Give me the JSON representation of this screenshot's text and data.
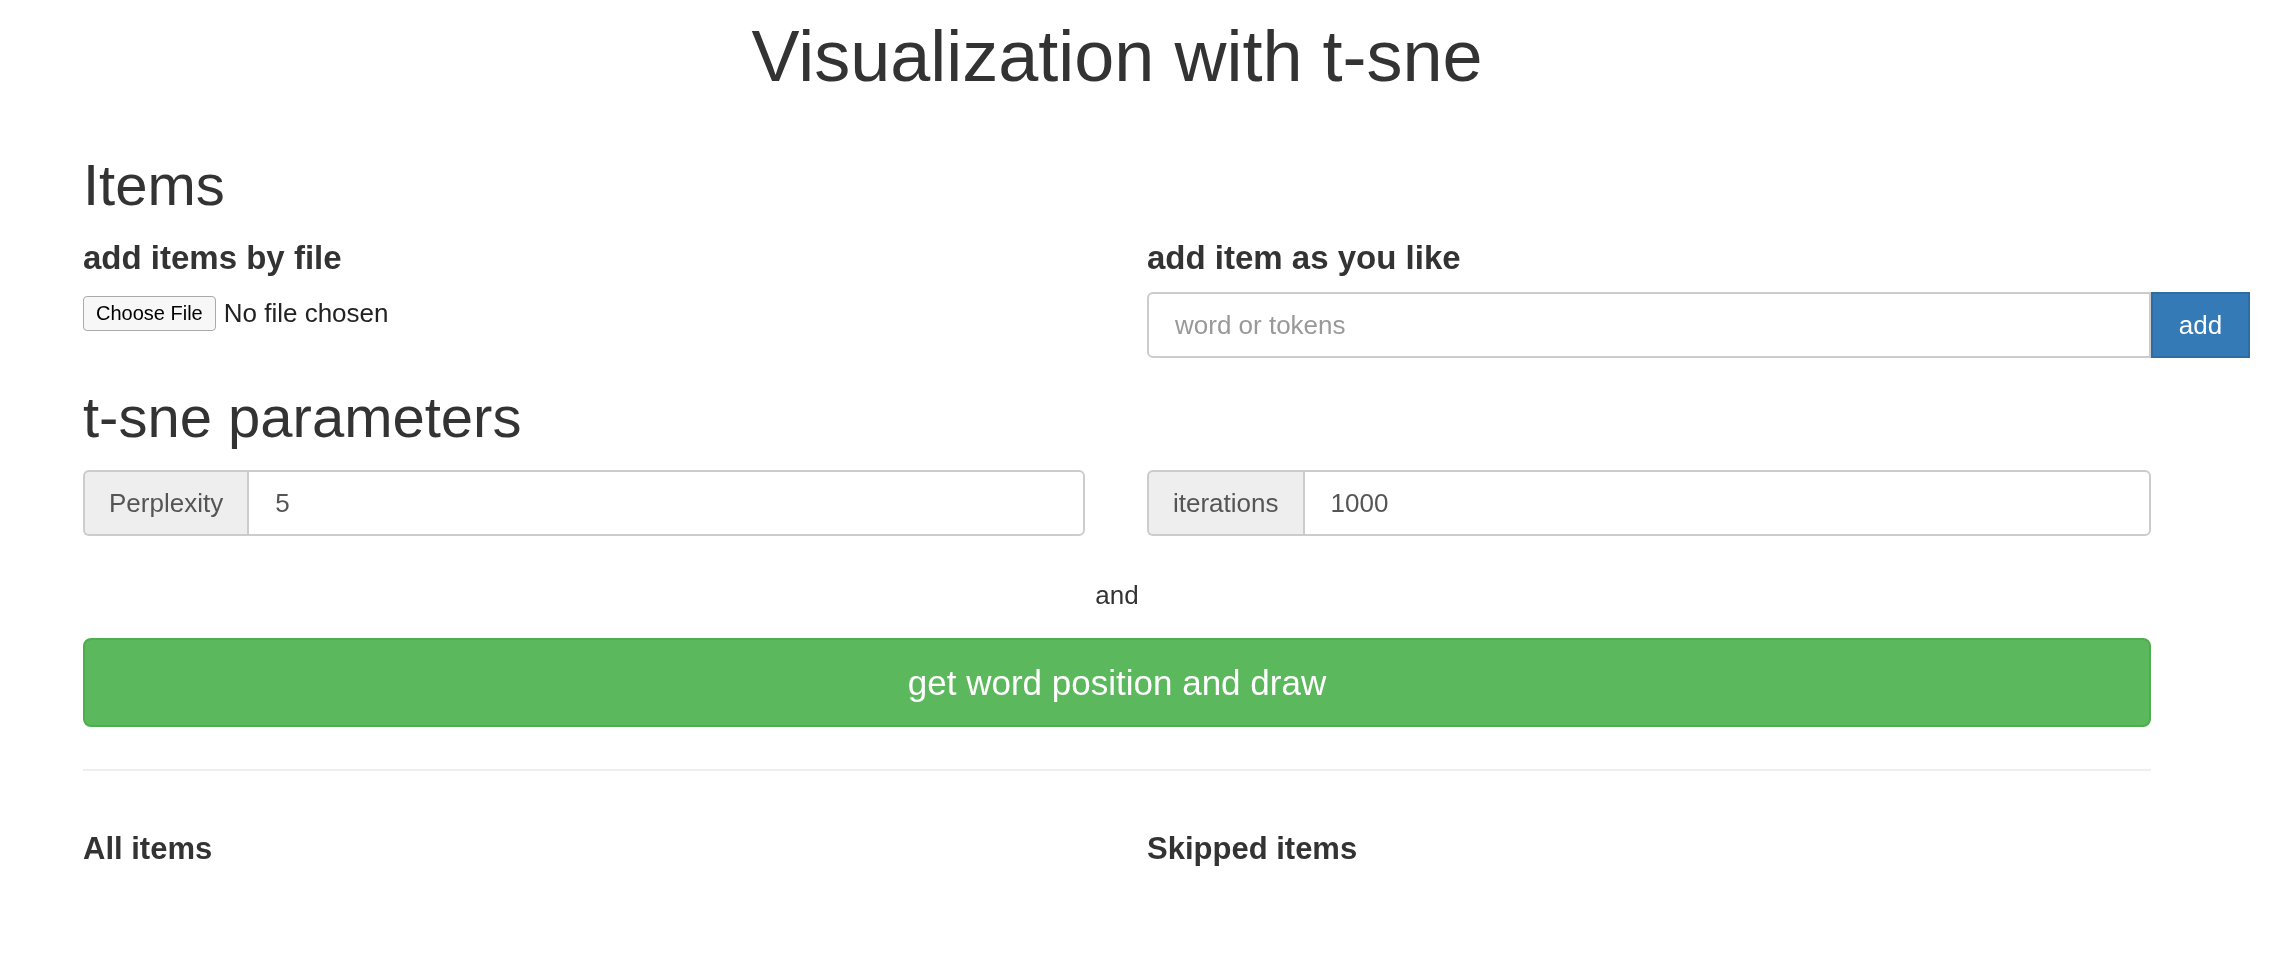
{
  "title": "Visualization with t-sne",
  "items": {
    "heading": "Items",
    "file_upload": {
      "label": "add items by file",
      "button": "Choose File",
      "status": "No file chosen"
    },
    "manual": {
      "label": "add item as you like",
      "placeholder": "word or tokens",
      "button": "add"
    }
  },
  "parameters": {
    "heading": "t-sne parameters",
    "fields": [
      {
        "label": "Perplexity",
        "value": "5"
      },
      {
        "label": "iterations",
        "value": "1000"
      }
    ]
  },
  "connector": "and",
  "submit_button": "get word position and draw",
  "lists": [
    {
      "heading": "All items"
    },
    {
      "heading": "Skipped items"
    }
  ]
}
